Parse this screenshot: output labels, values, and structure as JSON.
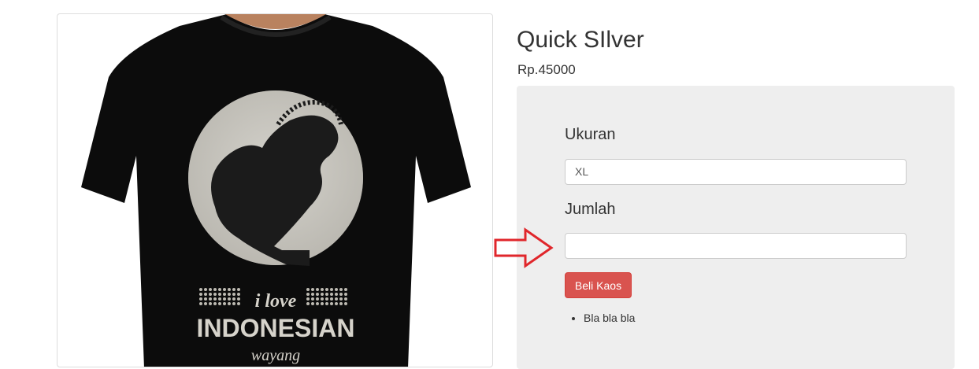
{
  "product": {
    "name": "Quick SIlver",
    "price": "Rp.45000",
    "image_alt": "Black t-shirt with wayang print",
    "print_text": {
      "line1": "i love",
      "line2": "INDONESIAN",
      "line3": "wayang"
    }
  },
  "form": {
    "size_label": "Ukuran",
    "size_value": "XL",
    "quantity_label": "Jumlah",
    "quantity_value": "",
    "submit_label": "Beli Kaos"
  },
  "features": [
    "Bla bla bla"
  ],
  "colors": {
    "panel_bg": "#eeeeee",
    "button_bg": "#d9534f",
    "annotation_arrow": "#e0262b"
  },
  "icons": {
    "annotation": "right-arrow-outline-icon"
  }
}
